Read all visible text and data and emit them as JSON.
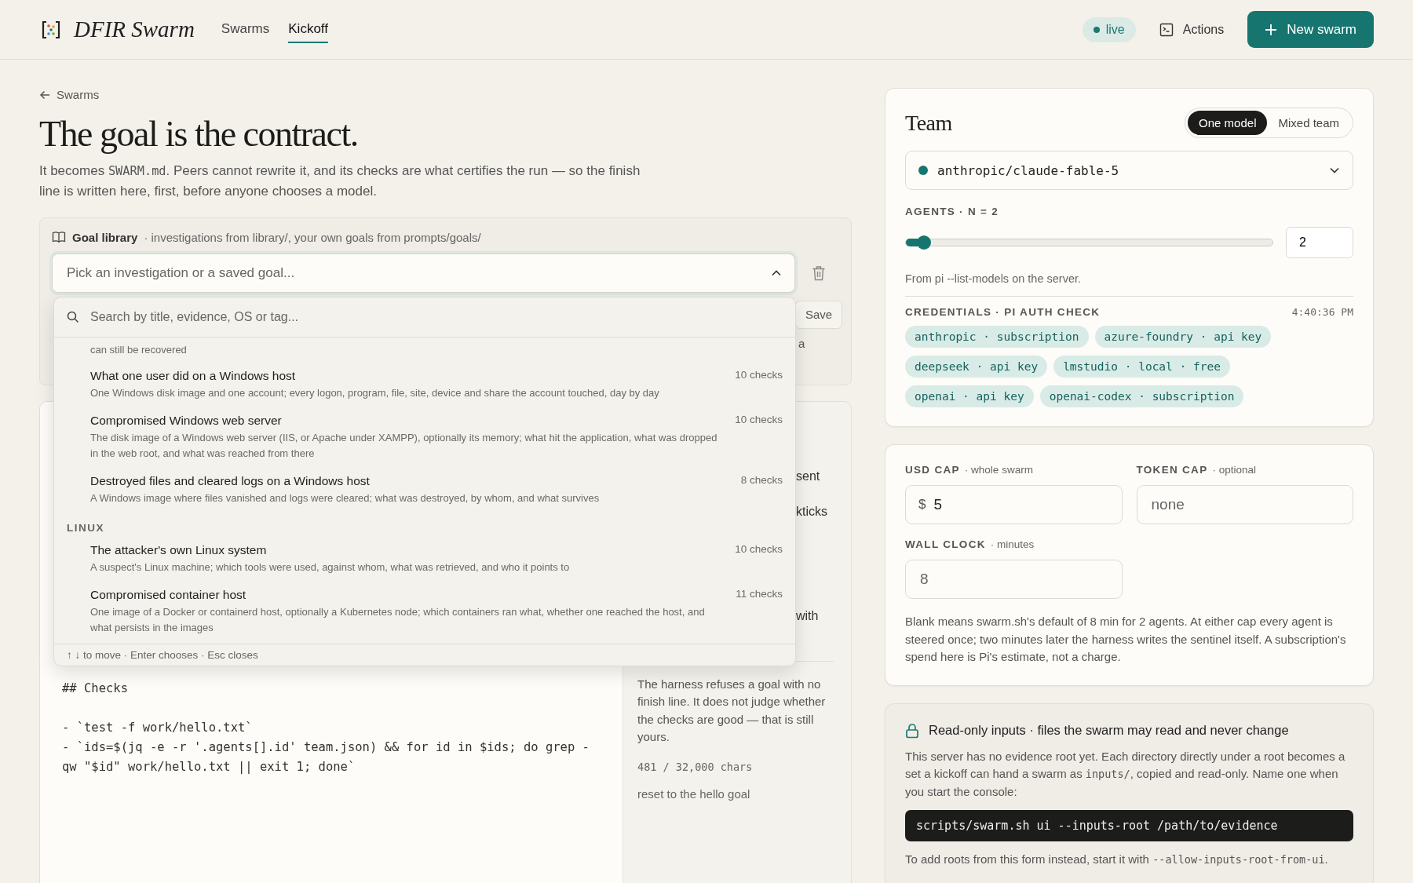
{
  "header": {
    "brand": "DFIR Swarm",
    "nav": [
      {
        "label": "Swarms",
        "selected": false
      },
      {
        "label": "Kickoff",
        "selected": true
      }
    ],
    "status": {
      "label": "live",
      "on": true
    },
    "actions_label": "Actions",
    "new_button": "New swarm"
  },
  "back_link": "Swarms",
  "title": "The goal is the contract.",
  "intro": [
    {
      "kind": "text",
      "text": "It becomes "
    },
    {
      "kind": "code",
      "text": "SWARM.md"
    },
    {
      "kind": "text",
      "text": ". Peers cannot rewrite it, and its checks are what certifies the run — so the finish line is written here, first, before anyone chooses a model."
    }
  ],
  "goal_library": {
    "label": "Goal library",
    "hint": "· investigations from library/, your own goals from prompts/goals/",
    "combobox": {
      "placeholder": "Pick an investigation or a saved goal...",
      "expanded": true
    },
    "save_button": "Save",
    "fragment": "a"
  },
  "dropdown": {
    "search_placeholder": "Search by title, evidence, OS or tag...",
    "items": [
      {
        "kind": "tail",
        "description": "can still be recovered"
      },
      {
        "kind": "option",
        "title": "What one user did on a Windows host",
        "description": "One Windows disk image and one account; every logon, program, file, site, device and share the account touched, day by day",
        "checks": "10 checks",
        "selected": false
      },
      {
        "kind": "option",
        "title": "Compromised Windows web server",
        "description": "The disk image of a Windows web server (IIS, or Apache under XAMPP), optionally its memory; what hit the application, what was dropped in the web root, and what was reached from there",
        "checks": "10 checks",
        "selected": false
      },
      {
        "kind": "option",
        "title": "Destroyed files and cleared logs on a Windows host",
        "description": "A Windows image where files vanished and logs were cleared; what was destroyed, by whom, and what survives",
        "checks": "8 checks",
        "selected": false
      },
      {
        "kind": "group",
        "label": "LINUX"
      },
      {
        "kind": "option",
        "title": "The attacker's own Linux system",
        "description": "A suspect's Linux machine; which tools were used, against whom, what was retrieved, and who it points to",
        "checks": "10 checks",
        "selected": false
      },
      {
        "kind": "option",
        "title": "Compromised container host",
        "description": "One image of a Docker or containerd host, optionally a Kubernetes node; which containers ran what, whether one reached the host, and what persists in the images",
        "checks": "11 checks",
        "selected": false
      }
    ],
    "footer": "↑ ↓ to move · Enter chooses · Esc closes"
  },
  "editor": {
    "fragments": [
      "sent",
      "kticks",
      "with"
    ],
    "code": [
      {
        "kind": "heading",
        "text": "## Checks"
      },
      {
        "kind": "item",
        "text": "- `test -f work/hello.txt`"
      },
      {
        "kind": "item",
        "text": "- `ids=$(jq -e -r '.agents[].id' team.json) && for id in $ids; do grep -qw \"$id\" work/hello.txt || exit 1; done`"
      }
    ],
    "note": "The harness refuses a goal with no finish line. It does not judge whether the checks are good — that is still yours.",
    "char_count": "481 / 32,000 chars",
    "reset_link": "reset to the hello goal"
  },
  "team": {
    "title": "Team",
    "modes": [
      {
        "label": "One model",
        "selected": true
      },
      {
        "label": "Mixed team",
        "selected": false
      }
    ],
    "model": "anthropic/claude-fable-5",
    "agents_label": "AGENTS · N = 2",
    "agents": {
      "level": 0.05,
      "value": "2"
    },
    "models_note": "From pi --list-models on the server.",
    "credentials_label": "CREDENTIALS · PI AUTH CHECK",
    "checked_at": "4:40:36 PM",
    "credentials": [
      "anthropic · subscription",
      "azure-foundry · api key",
      "deepseek · api key",
      "lmstudio · local · free",
      "openai · api key",
      "openai-codex · subscription"
    ]
  },
  "caps": {
    "usd": {
      "label": "USD CAP",
      "hint": "· whole swarm",
      "prefix": "$",
      "value": "5"
    },
    "token": {
      "label": "TOKEN CAP",
      "hint": "· optional",
      "placeholder": "none"
    },
    "wall": {
      "label": "WALL CLOCK",
      "hint": "· minutes",
      "placeholder": "8"
    },
    "note": "Blank means swarm.sh's default of 8 min for 2 agents. At either cap every agent is steered once; two minutes later the harness writes the sentinel itself. A subscription's spend here is Pi's estimate, not a charge."
  },
  "inputs": {
    "title": "Read-only inputs · files the swarm may read and never change",
    "intro": [
      {
        "kind": "text",
        "text": "This server has no evidence root yet. Each directory directly under a root becomes a set a kickoff can hand a swarm as "
      },
      {
        "kind": "code",
        "text": "inputs/"
      },
      {
        "kind": "text",
        "text": ", copied and read-only. Name one when you start the console:"
      }
    ],
    "command": "scripts/swarm.sh ui --inputs-root /path/to/evidence",
    "after": [
      {
        "kind": "text",
        "text": "To add roots from this form instead, start it with "
      },
      {
        "kind": "code",
        "text": "--allow-inputs-root-from-ui"
      },
      {
        "kind": "text",
        "text": "."
      }
    ]
  }
}
